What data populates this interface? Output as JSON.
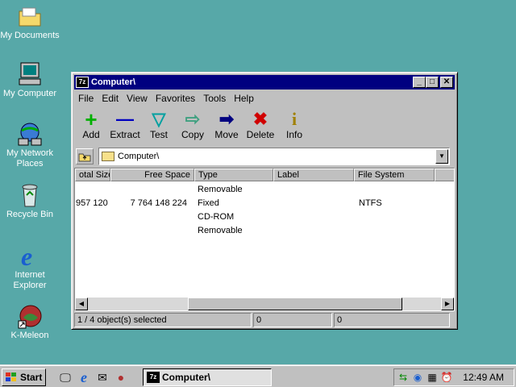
{
  "desktop": {
    "icons": [
      {
        "label": "My Documents"
      },
      {
        "label": "My Computer"
      },
      {
        "label": "My Network Places"
      },
      {
        "label": "Recycle Bin"
      },
      {
        "label": "Internet Explorer"
      },
      {
        "label": "K-Meleon"
      }
    ]
  },
  "window": {
    "title": "Computer\\",
    "title_icon": "7z",
    "menu": [
      "File",
      "Edit",
      "View",
      "Favorites",
      "Tools",
      "Help"
    ],
    "toolbar": [
      {
        "label": "Add",
        "icon": "plus-icon",
        "glyph": "+",
        "color": "#00b000"
      },
      {
        "label": "Extract",
        "icon": "minus-icon",
        "glyph": "—",
        "color": "#0000c0"
      },
      {
        "label": "Test",
        "icon": "check-arrow-icon",
        "glyph": "▽",
        "color": "#00a0a0"
      },
      {
        "label": "Copy",
        "icon": "copy-arrow-icon",
        "glyph": "⇨",
        "color": "#40a080"
      },
      {
        "label": "Move",
        "icon": "move-arrow-icon",
        "glyph": "➡",
        "color": "#000080"
      },
      {
        "label": "Delete",
        "icon": "delete-x-icon",
        "glyph": "✖",
        "color": "#d00000"
      },
      {
        "label": "Info",
        "icon": "info-icon",
        "glyph": "i",
        "color": "#a08000"
      }
    ],
    "address": "Computer\\",
    "columns": [
      "otal Size",
      "Free Space",
      "Type",
      "Label",
      "File System"
    ],
    "rows": [
      {
        "total": "",
        "free": "",
        "type": "Removable",
        "label": "",
        "fs": ""
      },
      {
        "total": "957 120",
        "free": "7 764 148 224",
        "type": "Fixed",
        "label": "",
        "fs": "NTFS"
      },
      {
        "total": "",
        "free": "",
        "type": "CD-ROM",
        "label": "",
        "fs": ""
      },
      {
        "total": "",
        "free": "",
        "type": "Removable",
        "label": "",
        "fs": ""
      }
    ],
    "status": [
      "1 / 4 object(s) selected",
      "0",
      "0"
    ]
  },
  "taskbar": {
    "start": "Start",
    "task": "Computer\\",
    "clock": "12:49 AM"
  }
}
